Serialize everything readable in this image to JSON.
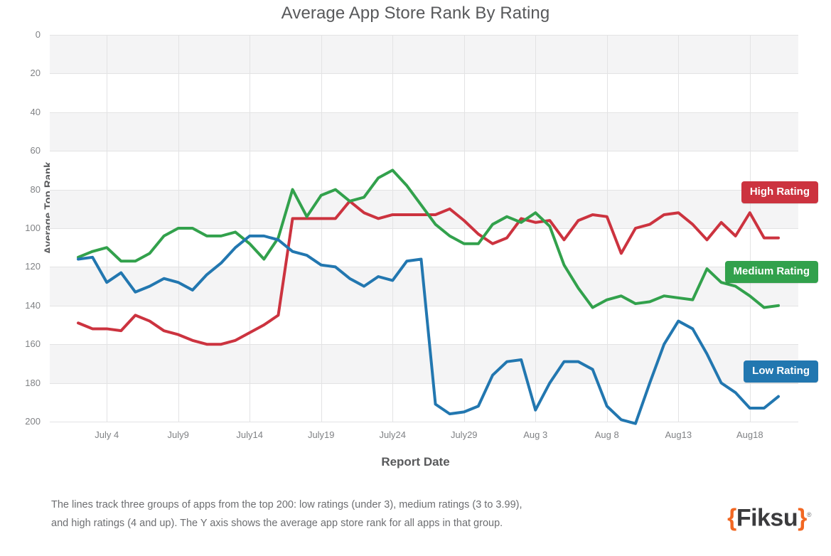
{
  "header": {
    "title": "Average App Store Rank By Rating"
  },
  "axes": {
    "y_title": "Average Top Rank",
    "x_title": "Report Date"
  },
  "legend": [
    {
      "id": "high",
      "label": "High Rating",
      "color": "#cc333f"
    },
    {
      "id": "medium",
      "label": "Medium Rating",
      "color": "#32a14c"
    },
    {
      "id": "low",
      "label": "Low Rating",
      "color": "#2277b0"
    }
  ],
  "footer": {
    "note_line1": "The lines track three groups of apps from the top 200: low ratings (under 3), medium ratings (3 to 3.99),",
    "note_line2": "and high ratings (4 and up). The Y axis shows the average app store rank for all apps in that group.",
    "brand_left_brace": "{",
    "brand_name": "Fiksu",
    "brand_right_brace": "}",
    "brand_registered": "®"
  },
  "chart_data": {
    "type": "line",
    "title": "Average App Store Rank By Rating",
    "xlabel": "Report Date",
    "ylabel": "Average Top Rank",
    "y_inverted": true,
    "ylim": [
      0,
      200
    ],
    "ytick_labels": [
      "0",
      "20",
      "40",
      "60",
      "80",
      "100",
      "120",
      "140",
      "160",
      "180",
      "200"
    ],
    "ytick_values": [
      0,
      20,
      40,
      60,
      80,
      100,
      120,
      140,
      160,
      180,
      200
    ],
    "xtick_labels": [
      "July 4",
      "July9",
      "July14",
      "July19",
      "July24",
      "July29",
      "Aug 3",
      "Aug 8",
      "Aug13",
      "Aug18"
    ],
    "xtick_indices": [
      2,
      7,
      12,
      17,
      22,
      27,
      32,
      37,
      42,
      47
    ],
    "x_index_range": [
      0,
      49
    ],
    "grid": true,
    "legend_position": "right-inline",
    "series": [
      {
        "name": "High Rating",
        "color": "#cc333f",
        "values": [
          149,
          152,
          152,
          153,
          145,
          148,
          153,
          155,
          158,
          160,
          160,
          158,
          154,
          150,
          145,
          95,
          95,
          95,
          95,
          86,
          92,
          95,
          93,
          93,
          93,
          93,
          90,
          96,
          103,
          108,
          105,
          95,
          97,
          96,
          106,
          96,
          93,
          94,
          113,
          100,
          98,
          93,
          92,
          98,
          106,
          97,
          104,
          92,
          105,
          105
        ]
      },
      {
        "name": "Medium Rating",
        "color": "#32a14c",
        "values": [
          115,
          112,
          110,
          117,
          117,
          113,
          104,
          100,
          100,
          104,
          104,
          102,
          108,
          116,
          105,
          80,
          94,
          83,
          80,
          86,
          84,
          74,
          70,
          78,
          88,
          98,
          104,
          108,
          108,
          98,
          94,
          97,
          92,
          99,
          119,
          131,
          141,
          137,
          135,
          139,
          138,
          135,
          136,
          137,
          121,
          128,
          130,
          135,
          141,
          140
        ]
      },
      {
        "name": "Low Rating",
        "color": "#2277b0",
        "values": [
          116,
          115,
          128,
          123,
          133,
          130,
          126,
          128,
          132,
          124,
          118,
          110,
          104,
          104,
          106,
          112,
          114,
          119,
          120,
          126,
          130,
          125,
          127,
          117,
          116,
          191,
          196,
          195,
          192,
          176,
          169,
          168,
          194,
          180,
          169,
          169,
          173,
          192,
          199,
          201,
          180,
          160,
          148,
          152,
          165,
          180,
          185,
          193,
          193,
          187
        ]
      }
    ]
  }
}
